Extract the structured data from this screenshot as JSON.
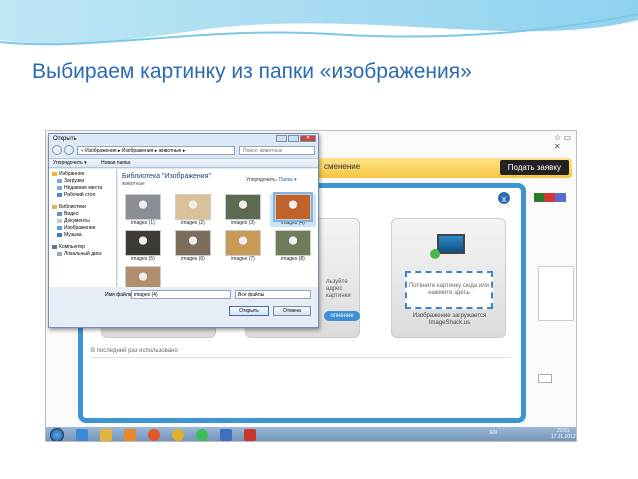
{
  "slide": {
    "title": "Выбираем картинку из папки «изображения»"
  },
  "browser": {
    "bar_text": "сменение",
    "submit_label": "Подать заявку",
    "top_icons": "☆ ▭ ✕"
  },
  "upload_dialog": {
    "close_label": "x",
    "card2_text": "льзуйте адрес картинки",
    "card2_button": "олнение",
    "drop_text": "Потяните картинку сюда или нажмите здесь",
    "card3_caption": "Изображение загружается ImageShack.us",
    "recent_label": "В последний раз использовано"
  },
  "file_dialog": {
    "title": "Открыть",
    "address": "« Изображения ▸ Изображения ▸ животные ▸",
    "search_placeholder": "Поиск: животные",
    "toolbar_organize": "Упорядочить ▾",
    "toolbar_new_folder": "Новая папка",
    "nav": {
      "favorites": "Избранное",
      "downloads": "Загрузки",
      "recent": "Недавние места",
      "desktop": "Рабочий стол",
      "libraries": "Библиотеки",
      "video": "Видео",
      "documents": "Документы",
      "images": "Изображения",
      "music": "Музыка",
      "computer": "Компьютер",
      "local_disk": "Локальный диск"
    },
    "library_title": "Библиотека \"Изображения\"",
    "library_subtitle": "животные",
    "sort_label": "Упорядочить:",
    "sort_value": "Папка ▾",
    "thumbnails": [
      {
        "caption": "images (1)",
        "color": "#8a8f96"
      },
      {
        "caption": "images (2)",
        "color": "#d9c29a"
      },
      {
        "caption": "images (3)",
        "color": "#5d6a52"
      },
      {
        "caption": "images (4)",
        "color": "#c0622a"
      },
      {
        "caption": "images (5)",
        "color": "#3e3a36"
      },
      {
        "caption": "images (6)",
        "color": "#7d6e5c"
      },
      {
        "caption": "images (7)",
        "color": "#c99a55"
      },
      {
        "caption": "images (8)",
        "color": "#6f7c5a"
      },
      {
        "caption": "",
        "color": "#b08e6e"
      }
    ],
    "filename_label": "Имя файла:",
    "filename_value": "images (4)",
    "filter_value": "Все файлы",
    "open_label": "Открыть",
    "cancel_label": "Отмена"
  },
  "taskbar": {
    "lang": "EN",
    "time": "23:01",
    "date": "17.11.2012"
  },
  "colors": {
    "title_blue": "#2a6bb0",
    "dialog_border": "#3d95d0",
    "accent_yellow": "#f6c640"
  }
}
